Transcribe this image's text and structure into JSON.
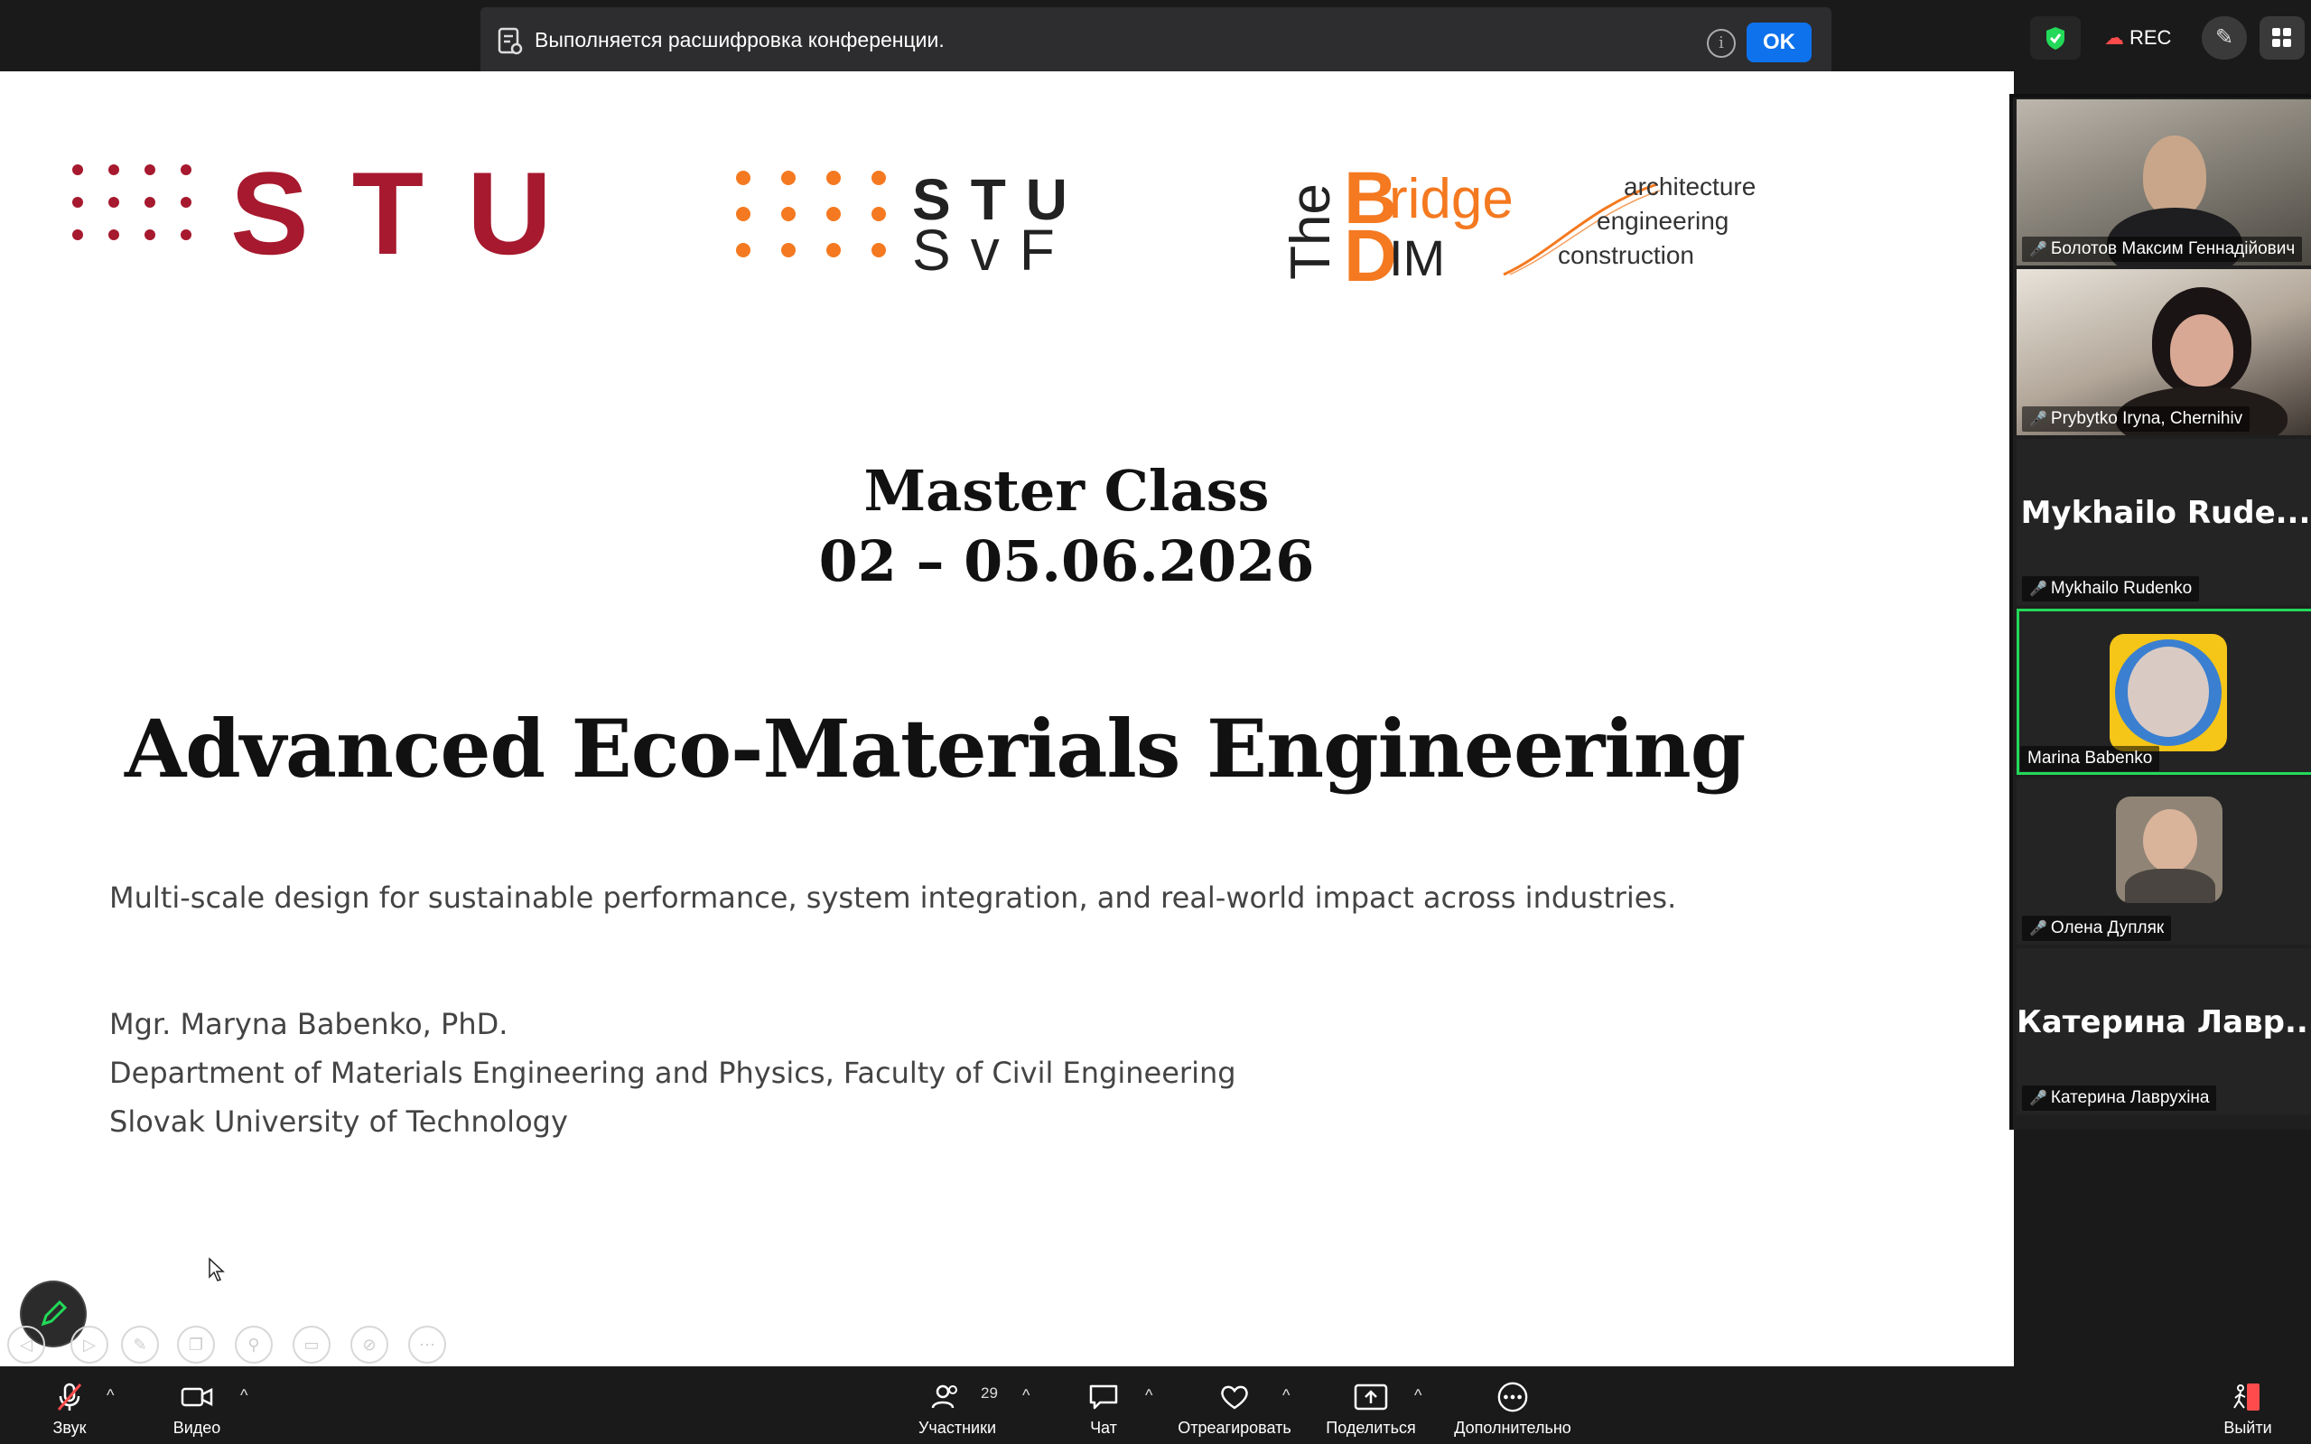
{
  "notification": {
    "message": "Выполняется расшифровка конференции.",
    "ok_label": "OK"
  },
  "top_right": {
    "rec_label": "REC"
  },
  "slide": {
    "logo_stu": "STU",
    "logo_svf_line1": "STU",
    "logo_svf_line2": "SvF",
    "logo_bridge": {
      "the": "The",
      "b": "B",
      "ridge": "ridge",
      "d": "D",
      "im": "IM",
      "tags": [
        "architecture",
        "engineering",
        "construction"
      ]
    },
    "heading_line1": "Master Class",
    "heading_line2": "02 – 05.06.2026",
    "title": "Advanced Eco-Materials Engineering",
    "subtitle": "Multi-scale design for sustainable performance, system integration, and real-world impact across industries.",
    "author": "Mgr. Maryna Babenko, PhD.",
    "department": "Department of Materials Engineering and Physics, Faculty of Civil Engineering",
    "university": "Slovak University of Technology"
  },
  "participants": [
    {
      "name": "Болотов Максим Геннадійович",
      "muted": true,
      "video": true
    },
    {
      "name": "Prybytko Iryna, Chernihiv",
      "muted": true,
      "video": true
    },
    {
      "name": "Mykhailo Rudenko",
      "display": "Mykhailo  Rude...",
      "muted": true,
      "video": false
    },
    {
      "name": "Marina Babenko",
      "muted": false,
      "video": false,
      "active": true
    },
    {
      "name": "Олена Дупляк",
      "muted": true,
      "video": false
    },
    {
      "name": "Катерина Лаврухіна",
      "display": "Катерина  Лавр...",
      "muted": true,
      "video": false
    }
  ],
  "toolbar": {
    "audio": "Звук",
    "video": "Видео",
    "participants": "Участники",
    "participants_count": "29",
    "chat": "Чат",
    "react": "Отреагировать",
    "share": "Поделиться",
    "more": "Дополнительно",
    "leave": "Выйти"
  },
  "colors": {
    "stu_red": "#a6192e",
    "svf_orange": "#f47920",
    "accent_blue": "#0e72ed",
    "active_speaker": "#23d959"
  }
}
